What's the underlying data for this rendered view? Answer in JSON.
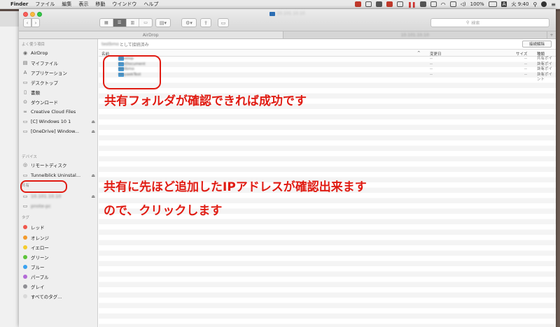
{
  "menubar": {
    "app": "Finder",
    "items": [
      "ファイル",
      "編集",
      "表示",
      "移動",
      "ウインドウ",
      "ヘルプ"
    ],
    "battery": "100%",
    "input_method": "A",
    "clock": "火 9:40"
  },
  "window": {
    "title": "10.101.10.10",
    "search_placeholder": "検索",
    "view_modes": [
      "icon-view",
      "list-view",
      "column-view",
      "cover-flow-view"
    ]
  },
  "tabs": [
    {
      "label": "AirDrop",
      "active": true
    },
    {
      "label": "10.101.10.10",
      "active": false
    }
  ],
  "sidebar": {
    "favorites_header": "よく使う項目",
    "favorites": [
      {
        "label": "AirDrop",
        "icon": "airdrop-icon"
      },
      {
        "label": "マイファイル",
        "icon": "all-files-icon"
      },
      {
        "label": "アプリケーション",
        "icon": "applications-icon"
      },
      {
        "label": "デスクトップ",
        "icon": "desktop-icon"
      },
      {
        "label": "書類",
        "icon": "documents-icon"
      },
      {
        "label": "ダウンロード",
        "icon": "downloads-icon"
      },
      {
        "label": "Creative Cloud Files",
        "icon": "creative-cloud-icon"
      },
      {
        "label": "[C] Windows 10 1",
        "icon": "drive-icon",
        "eject": true
      },
      {
        "label": "[OneDrive] Window...",
        "icon": "drive-icon",
        "eject": true
      }
    ],
    "devices_header": "デバイス",
    "devices": [
      {
        "label": "リモートディスク",
        "icon": "remote-disc-icon"
      },
      {
        "label": "Tunnelblick Uninstal...",
        "icon": "disk-icon",
        "eject": true
      }
    ],
    "shared_header": "共有",
    "shared": [
      {
        "label": "10.101.10.10",
        "icon": "monitor-icon",
        "eject": true
      },
      {
        "label": "pnote-pc",
        "icon": "pc-icon"
      }
    ],
    "tags_header": "タグ",
    "tags": [
      {
        "label": "レッド",
        "color": "#f0564c"
      },
      {
        "label": "オレンジ",
        "color": "#f39a2b"
      },
      {
        "label": "イエロー",
        "color": "#f5cc2c"
      },
      {
        "label": "グリーン",
        "color": "#5cc33a"
      },
      {
        "label": "ブルー",
        "color": "#3aa2f0"
      },
      {
        "label": "パープル",
        "color": "#b36ad7"
      },
      {
        "label": "グレイ",
        "color": "#8e8e93"
      },
      {
        "label": "すべてのタグ...",
        "color": "#d9d9d9"
      }
    ]
  },
  "content": {
    "connection_user": "testbmo",
    "connection_suffix": "として接続済み",
    "disconnect_label": "接続解除",
    "columns": {
      "name": "名前",
      "date": "変更日",
      "size": "サイズ",
      "kind": "種類"
    },
    "rows": [
      {
        "name": "develop",
        "date": "--",
        "size": "--",
        "kind": "共有ポイント"
      },
      {
        "name": "EnvDocument",
        "date": "--",
        "size": "--",
        "kind": "共有ポイント"
      },
      {
        "name": "testbmo",
        "date": "--",
        "size": "--",
        "kind": "共有ポイント"
      },
      {
        "name": "tasyaekTest",
        "date": "--",
        "size": "--",
        "kind": "共有ポイント"
      }
    ]
  },
  "annotations": {
    "files_note": "共有フォルダが確認できれば成功です",
    "ip_note_line1": "共有に先ほど追加したIPアドレスが確認出来ます",
    "ip_note_line2": "ので、クリックします"
  }
}
